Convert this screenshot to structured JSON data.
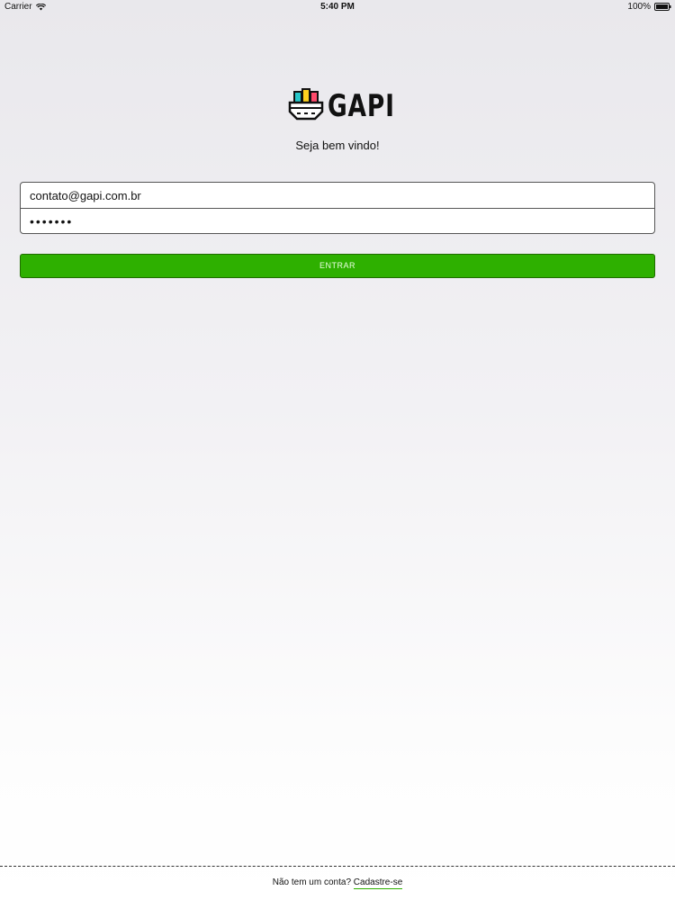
{
  "status_bar": {
    "carrier": "Carrier",
    "time": "5:40 PM",
    "battery": "100%"
  },
  "logo": {
    "text": "GAPI",
    "icon": "gapi-logo-icon"
  },
  "welcome_text": "Seja bem vindo!",
  "form": {
    "email_value": "contato@gapi.com.br",
    "password_value": "•••••••",
    "submit_label": "ENTRAR"
  },
  "footer": {
    "prompt": "Não tem um conta?",
    "signup_label": "Cadastre-se"
  },
  "colors": {
    "primary_button": "#2eb000",
    "link_underline": "#2eb000"
  }
}
